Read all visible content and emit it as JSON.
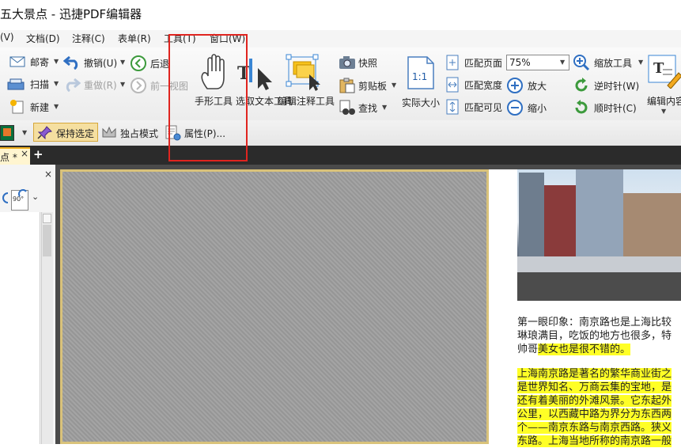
{
  "title": "五大景点 - 迅捷PDF编辑器",
  "menu": [
    "(V)",
    "文档(D)",
    "注释(C)",
    "表单(R)",
    "工具(T)",
    "窗口(W)"
  ],
  "ribbon": {
    "mail": "邮寄",
    "scan": "扫描",
    "new": "新建",
    "undo": "撤销(U)",
    "redo": "重做(R)",
    "back": "后退",
    "prev_view": "前一视图",
    "hand_tool": "手形工具",
    "select_text_tool": "选取文本工具",
    "edit_annotation_tool": "编辑注释工具",
    "snapshot": "快照",
    "clipboard": "剪贴板",
    "find": "查找",
    "actual_size": "实际大小",
    "actual_size_glyph": "1:1",
    "fit_page": "匹配页面",
    "fit_width": "匹配宽度",
    "fit_visible": "匹配可见",
    "zoom_value": "75%",
    "zoom_tool": "缩放工具",
    "zoom_in": "放大",
    "zoom_out": "缩小",
    "rotate_ccw": "逆时针(W)",
    "rotate_cw": "顺时针(C)",
    "edit_content": "编辑内容"
  },
  "quickbar": {
    "keep_selected": "保持选定",
    "exclusive_mode": "独占模式",
    "properties": "属性(P)..."
  },
  "tab": {
    "doc_name": "点 *",
    "close": "×",
    "add": "+"
  },
  "panel": {
    "close": "×",
    "rotate_glyph": "90°"
  },
  "document": {
    "para1": [
      {
        "text": "第一眼印象：南京路也是上海比较",
        "hl": false
      },
      {
        "text": "琳琅满目，吃饭的地方也很多，特",
        "hl": false
      }
    ],
    "para1_line3_plain": "帅哥",
    "para1_line3_hl": "美女也是很不错的。",
    "para2": [
      "上海南京路是著名的繁华商业街之",
      "是世界知名、万商云集的宝地，是",
      "还有着美丽的外滩风景。它东起外",
      "公里，以西藏中路为界分为东西两",
      "个——南京东路与南京西路。狭义",
      "东路。上海当地所称的南京路一般"
    ]
  },
  "colors": {
    "highlight": "#ffff26",
    "annotation_box": "#e0241f",
    "tab_bar": "#2b2b2b"
  }
}
